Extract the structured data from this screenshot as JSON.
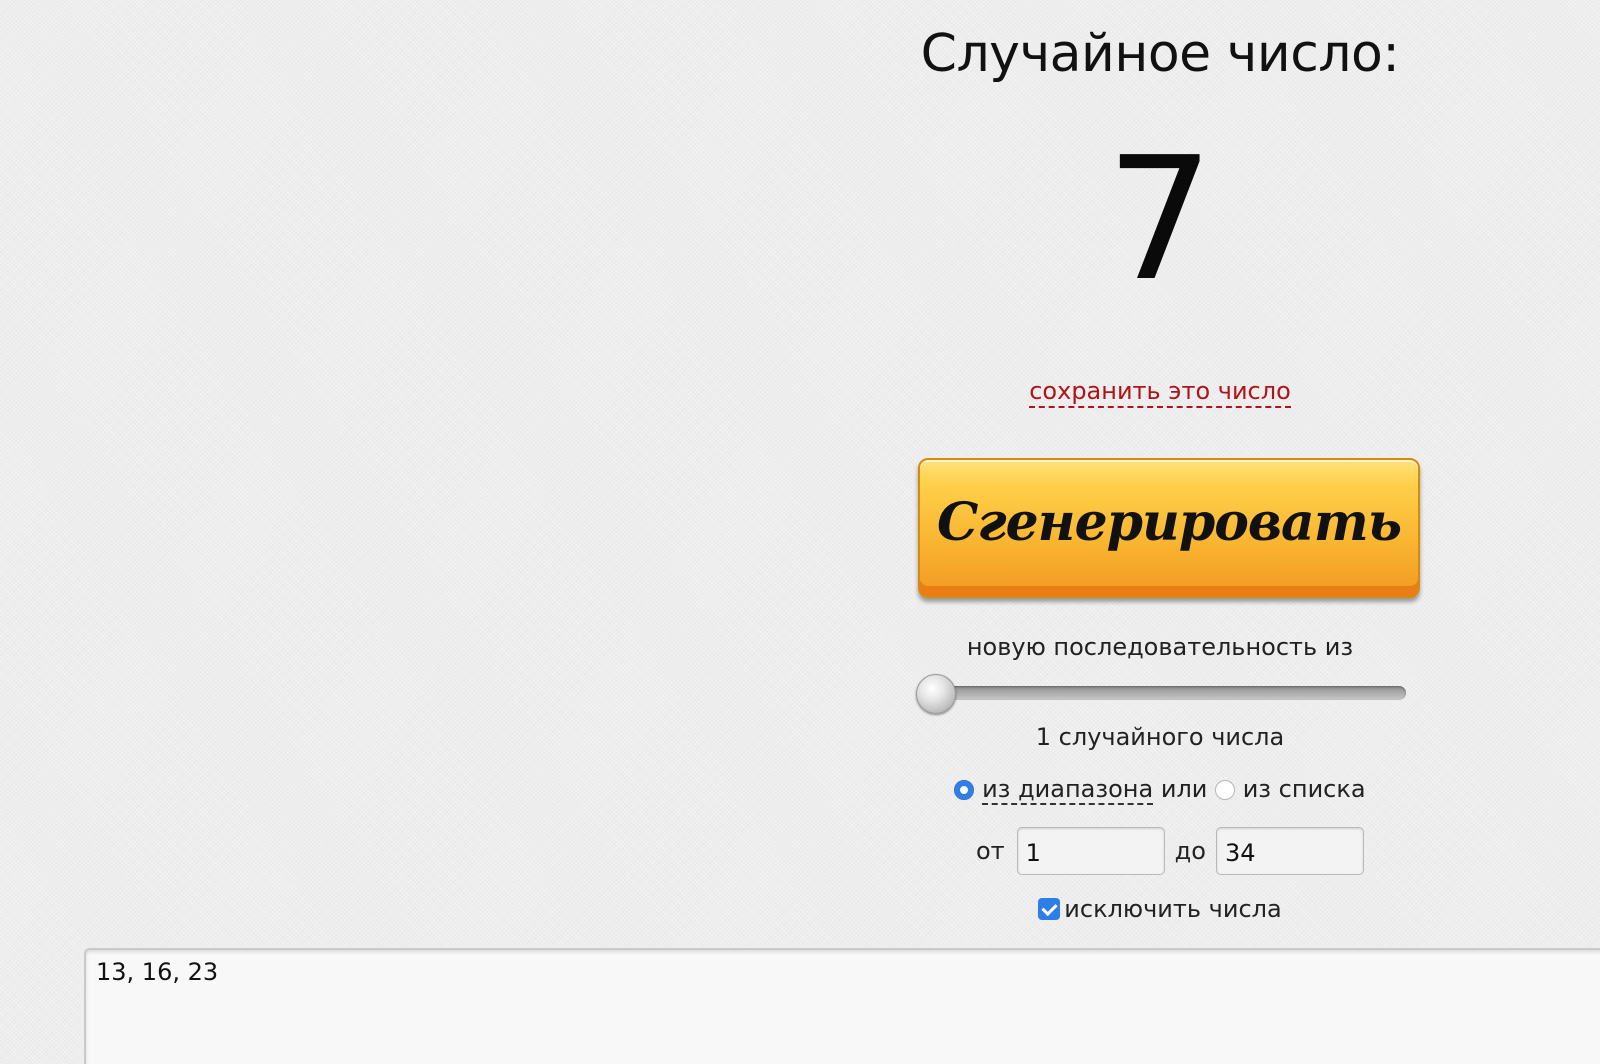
{
  "title": "Случайное число:",
  "result": "7",
  "save_link": "сохранить это число",
  "generate_button": "Сгенерировать",
  "sequence": {
    "label": "новую последовательность из",
    "slider_value": 1,
    "slider_min": 1,
    "slider_max": 100,
    "count_text": "1 случайного числа"
  },
  "mode": {
    "range_label": "из диапазона",
    "or_text": "или",
    "list_label": "из списка",
    "selected": "range"
  },
  "range": {
    "from_label": "от",
    "from_value": "1",
    "to_label": "до",
    "to_value": "34"
  },
  "exclude": {
    "checked": true,
    "label": "исключить числа",
    "numbers": "13, 16, 23"
  },
  "colors": {
    "link": "#b0141a",
    "button": "#f9b531",
    "accent": "#2f7de6"
  }
}
